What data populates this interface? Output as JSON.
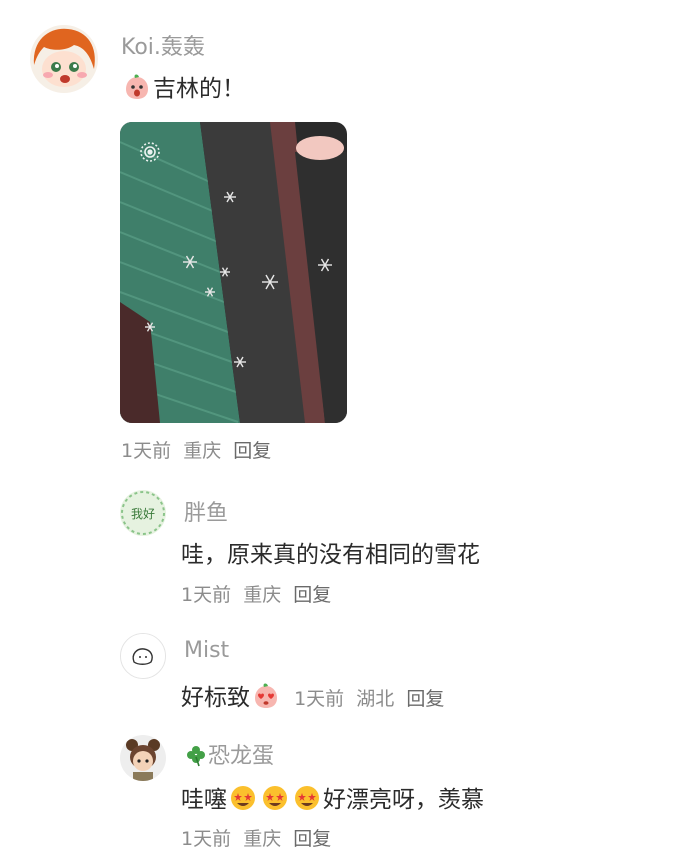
{
  "main_comment": {
    "username": "Koi.轰轰",
    "text": "吉林的！",
    "time": "1天前",
    "location": "重庆",
    "reply_label": "回复"
  },
  "replies": [
    {
      "username": "胖鱼",
      "avatar_text": "我好",
      "text": "哇，原来真的没有相同的雪花",
      "time": "1天前",
      "location": "重庆",
      "reply_label": "回复"
    },
    {
      "username": "Mist",
      "text": "好标致",
      "time": "1天前",
      "location": "湖北",
      "reply_label": "回复"
    },
    {
      "username": "恐龙蛋",
      "text_a": "哇噻",
      "text_b": "好漂亮呀，羡慕",
      "time": "1天前",
      "location": "重庆",
      "reply_label": "回复"
    }
  ]
}
